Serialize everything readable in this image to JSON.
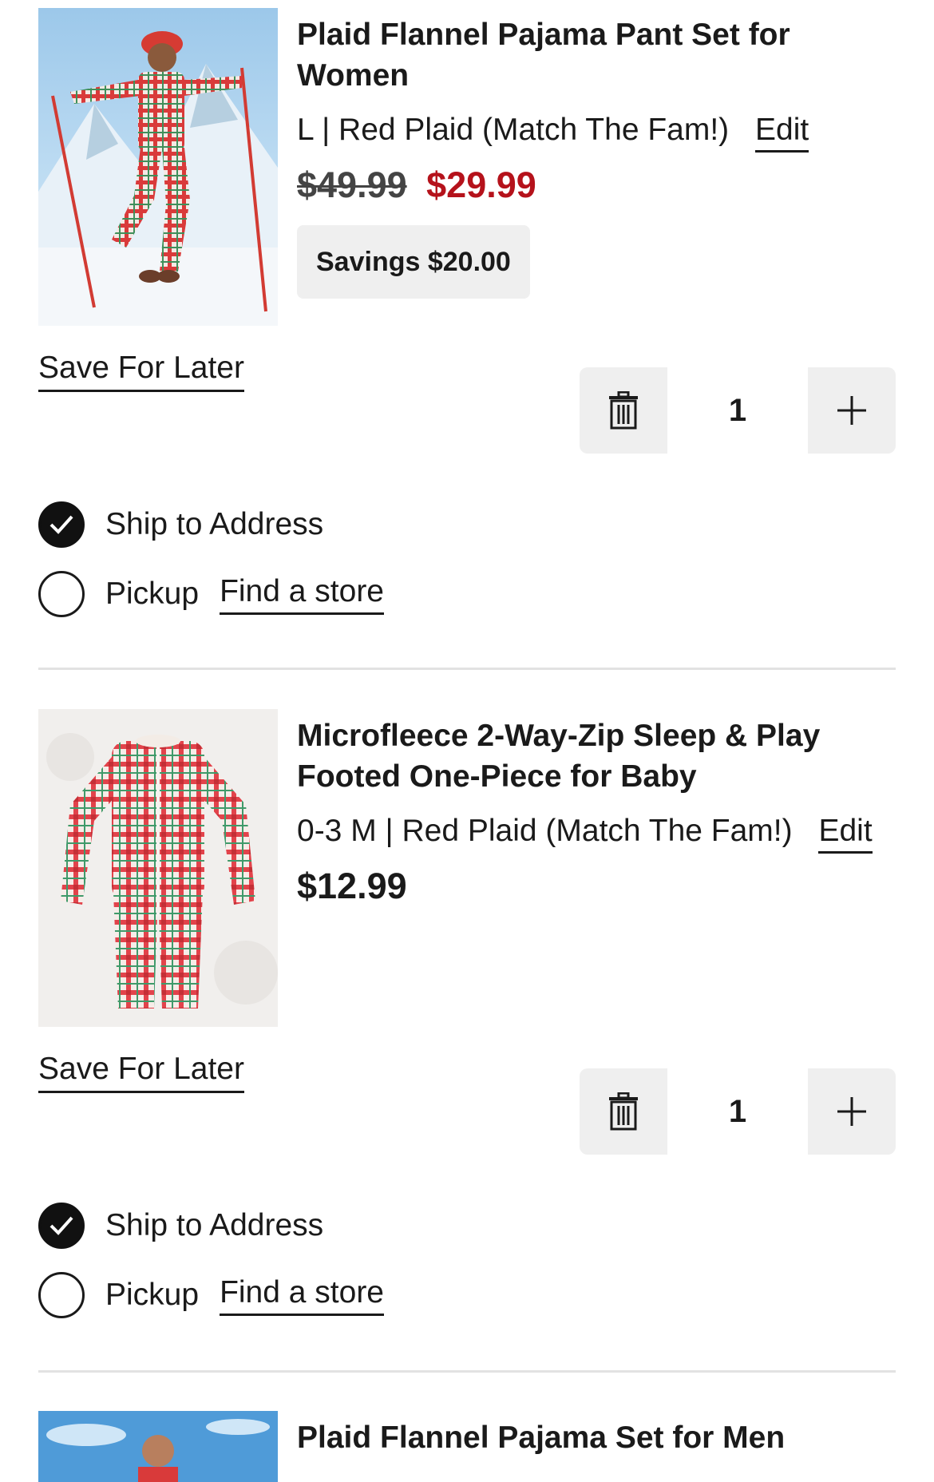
{
  "items": [
    {
      "title": "Plaid Flannel Pajama Pant Set for Women",
      "variant": "L | Red Plaid (Match The Fam!)",
      "edit_label": "Edit",
      "original_price": "$49.99",
      "price": "$29.99",
      "savings": "Savings $20.00",
      "save_for_later": "Save For Later",
      "quantity": "1",
      "ship_label": "Ship to Address",
      "pickup_label": "Pickup",
      "find_store_label": "Find a store",
      "selected_fulfillment": "ship"
    },
    {
      "title": "Microfleece 2-Way-Zip Sleep & Play Footed One-Piece for Baby",
      "variant": "0-3 M | Red Plaid (Match The Fam!)",
      "edit_label": "Edit",
      "price": "$12.99",
      "save_for_later": "Save For Later",
      "quantity": "1",
      "ship_label": "Ship to Address",
      "pickup_label": "Pickup",
      "find_store_label": "Find a store",
      "selected_fulfillment": "ship"
    },
    {
      "title": "Plaid Flannel Pajama Set for Men"
    }
  ],
  "icons": {
    "delete": "trash-icon",
    "increase": "plus-icon",
    "checked": "checkmark-icon"
  },
  "colors": {
    "sale_price": "#b5121b",
    "text": "#1a1a1a",
    "stepper_bg": "#efefef",
    "badge_bg": "#efefef",
    "divider": "#e2e2e2"
  }
}
